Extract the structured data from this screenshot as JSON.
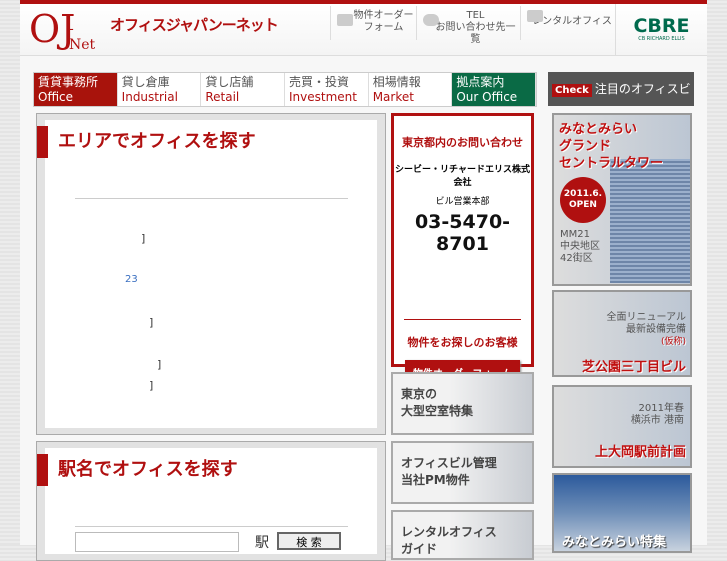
{
  "header": {
    "logo_main": "OJ",
    "logo_sub": "-Net",
    "site_title": "オフィスジャパンーネット",
    "links": [
      {
        "label": "物件オーダー\nフォーム",
        "line1": "物件オーダー",
        "line2": "フォーム"
      },
      {
        "line1": "TEL",
        "line2": "お問い合わせ先一覧"
      },
      {
        "line1": "レンタルオフィス"
      }
    ],
    "brand": "CBRE",
    "brand_sub": "CB RICHARD ELLIS"
  },
  "nav": [
    {
      "ja": "賃貸事務所",
      "en": "Office"
    },
    {
      "ja": "貸し倉庫",
      "en": "Industrial"
    },
    {
      "ja": "貸し店舗",
      "en": "Retail"
    },
    {
      "ja": "売買・投資",
      "en": "Investment"
    },
    {
      "ja": "相場情報",
      "en": "Market"
    },
    {
      "ja": "拠点案内",
      "en": "Our Office"
    }
  ],
  "check": {
    "badge": "Check",
    "title": "注目のオフィスビル"
  },
  "area": {
    "title": "エリアでオフィスを探す",
    "items": [
      "]",
      "23",
      "]",
      "]",
      "]"
    ]
  },
  "station": {
    "title": "駅名でオフィスを探す",
    "suffix": "駅",
    "search": "検 索",
    "value": ""
  },
  "contact": {
    "title": "東京都内のお問い合わせ",
    "company": "シービー・リチャードエリス株式会社",
    "dept": "ビル営業本部",
    "tel": "03-5470-8701",
    "dash": "—",
    "customer": "物件をお探しのお客様",
    "button": "物件オーダーフォーム"
  },
  "banners": [
    {
      "l1": "東京の",
      "l2": "大型空室特集"
    },
    {
      "l1": "オフィスビル管理",
      "l2": "当社PM物件"
    },
    {
      "l1": "レンタルオフィス",
      "l2": "ガイド"
    }
  ],
  "featured": [
    {
      "title": [
        "みなとみらい",
        "グランド",
        "セントラルタワー"
      ],
      "badge1": "2011.6.",
      "badge2": "OPEN",
      "info": [
        "MM21",
        "中央地区",
        "42街区"
      ]
    },
    {
      "info": [
        "全面リニューアル",
        "最新設備完備"
      ],
      "note": "(仮称)",
      "title": "芝公園三丁目ビル"
    },
    {
      "info": [
        "2011年春",
        "横浜市 港南"
      ],
      "title": "上大岡駅前計画"
    },
    {
      "title": "みなとみらい特集"
    }
  ]
}
